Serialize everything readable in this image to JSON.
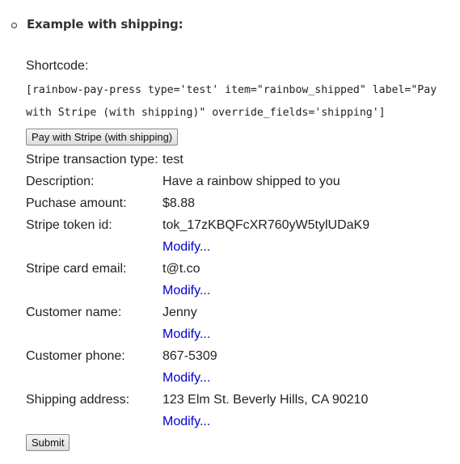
{
  "section": {
    "heading": "Example with shipping:",
    "shortcode_label": "Shortcode:",
    "shortcode": "[rainbow-pay-press type='test' item=\"rainbow_shipped\" label=\"Pay with Stripe (with shipping)\" override_fields='shipping']",
    "pay_button_label": "Pay with Stripe (with shipping)"
  },
  "details": {
    "transaction_type": {
      "label": "Stripe transaction type:",
      "value": "test"
    },
    "description": {
      "label": "Description:",
      "value": "Have a rainbow shipped to you"
    },
    "amount": {
      "label": "Puchase amount:",
      "value": "$8.88"
    },
    "token": {
      "label": "Stripe token id:",
      "value": "tok_17zKBQFcXR760yW5tylUDaK9",
      "modify": "Modify..."
    },
    "email": {
      "label": "Stripe card email:",
      "value": "t@t.co",
      "modify": "Modify..."
    },
    "name": {
      "label": "Customer name:",
      "value": "Jenny",
      "modify": "Modify..."
    },
    "phone": {
      "label": "Customer phone:",
      "value": "867-5309",
      "modify": "Modify..."
    },
    "address": {
      "label": "Shipping address:",
      "value": "123 Elm St. Beverly Hills, CA 90210",
      "modify": "Modify..."
    }
  },
  "submit_label": "Submit"
}
